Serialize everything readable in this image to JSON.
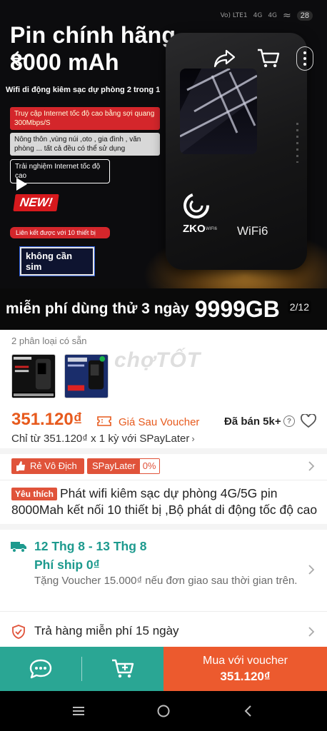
{
  "status_bar": {
    "signal_1": "Vo) LTE1",
    "signal_2": "4G",
    "signal_3": "4G",
    "battery": "28"
  },
  "hero": {
    "title_line1": "Pin chính hãng",
    "title_line2": "8000 mAh",
    "subtitle": "Wifi di động kiêm sạc dự phòng 2 trong 1",
    "promo_red": "Truy cập Internet tốc độ cao bằng sợi quang 300Mbps/S",
    "promo_gray": "Nông thôn ,vùng núi ,oto , gia đình , văn phòng ... tất cả đều có thể sử dụng",
    "promo_dark": "Trải nghiệm Internet tốc độ cao",
    "new_badge": "NEW!",
    "promo_connect": "Liên kết được với 10 thiết bị",
    "no_sim": "không cần sim",
    "device_brand": "ZKO",
    "device_brand_small": "WIFI6",
    "device_wifi6": "WiFi6",
    "banner_free": "miễn phí dùng thử 3 ngày",
    "banner_big": "9999GB",
    "image_counter": "2/12"
  },
  "variants": {
    "label": "2 phân loại có sẵn"
  },
  "watermark": "chợTỐT",
  "price": {
    "value": "351.120₫",
    "voucher_label": "Giá Sau Voucher",
    "sold": "Đã bán 5k+",
    "spaylater_line": "Chỉ từ 351.120₫ x 1 kỳ với SPayLater"
  },
  "tags": {
    "re_vo_dich": "Rẻ Vô Địch",
    "spaylater": "SPayLater",
    "spaylater_rate": "0%"
  },
  "product": {
    "fav_badge": "Yêu thích",
    "title": "Phát wifi kiêm sạc dự phòng  4G/5G pin 8000Mah kết nối 10 thiết bị ,Bộ phát di động tốc độ cao"
  },
  "shipping": {
    "date": "12 Thg 8 - 13 Thg 8",
    "fee": "Phí ship 0₫",
    "note": "Tặng Voucher 15.000₫ nếu đơn giao sau thời gian trên."
  },
  "return_policy": {
    "text": "Trả hàng miễn phí 15 ngày"
  },
  "action_bar": {
    "buy_line1": "Mua với voucher",
    "buy_line2": "351.120₫"
  },
  "colors": {
    "accent_orange": "#e75a1d",
    "teal": "#2aa694",
    "buy_orange": "#ec5a2e",
    "tag_red": "#e0533a"
  }
}
